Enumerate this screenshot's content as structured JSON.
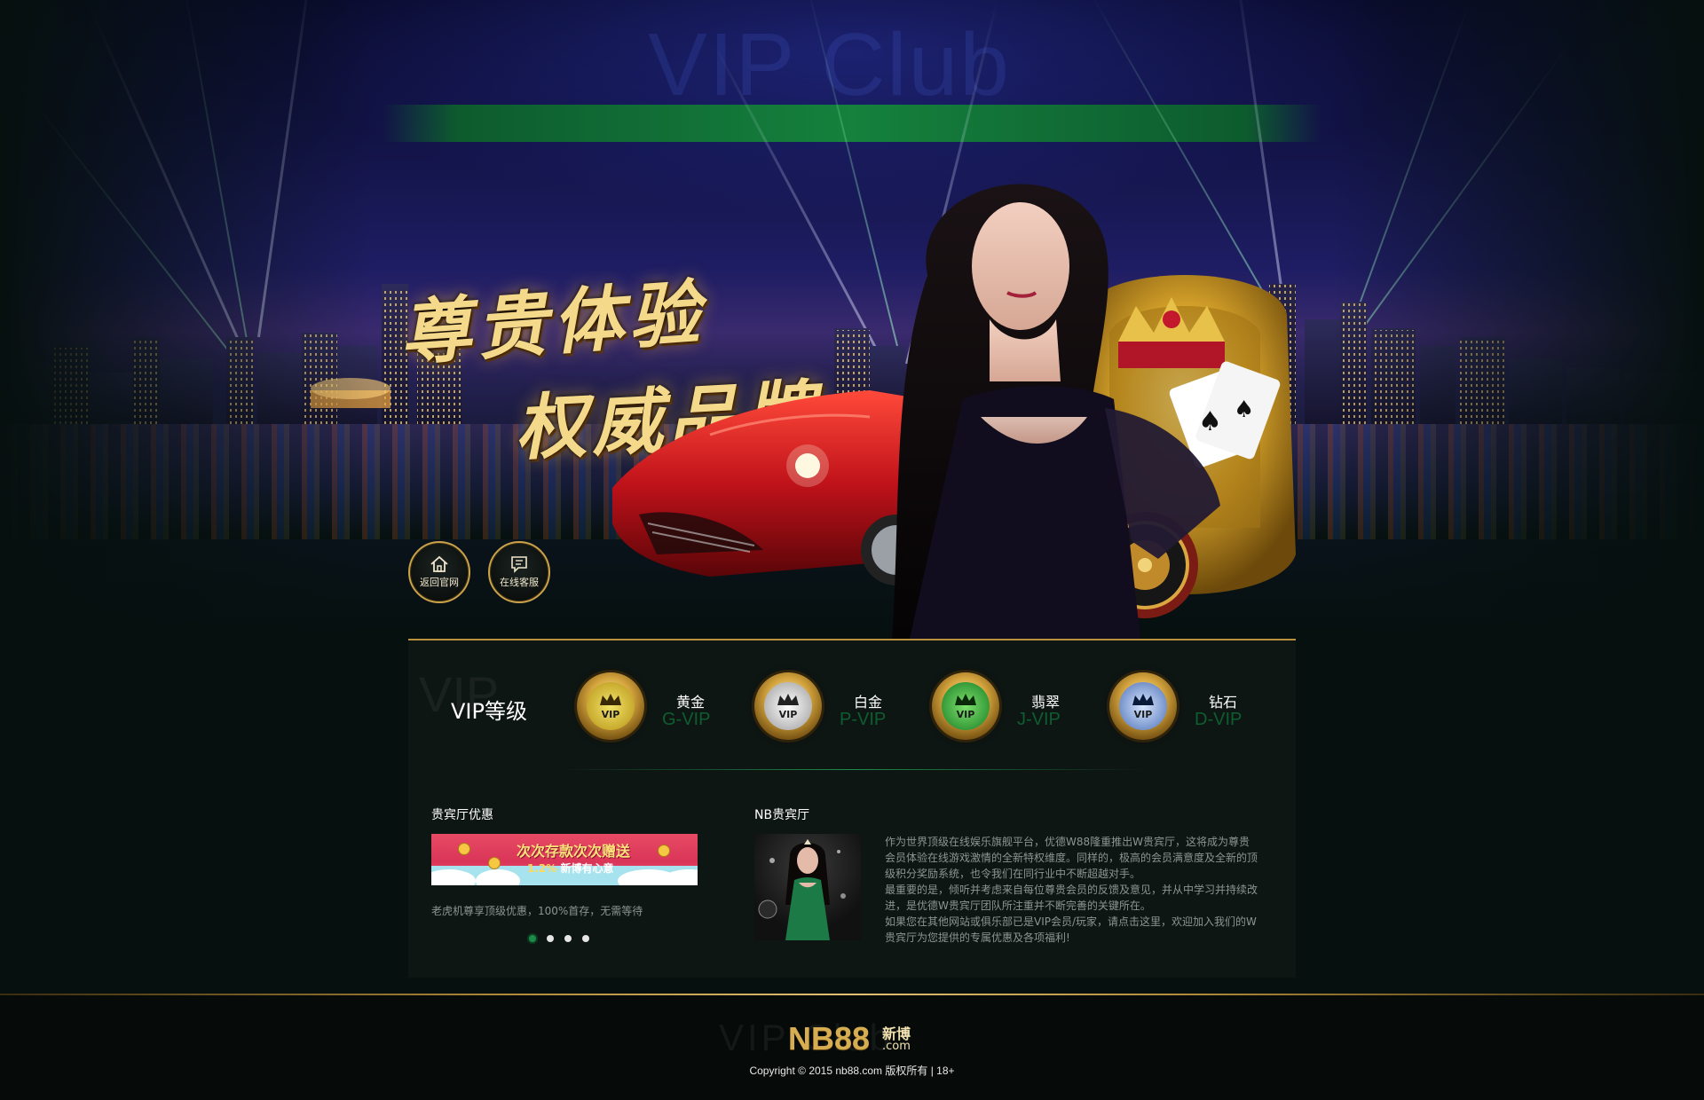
{
  "hero": {
    "watermark": "VIP Club",
    "headline_line1": "尊贵体验",
    "headline_line2": "权威品牌",
    "buttons": {
      "home_label": "返回官网",
      "service_label": "在线客服"
    }
  },
  "vip": {
    "watermark": "VIP",
    "title": "VIP等级",
    "badge_text": "VIP",
    "tiers": [
      {
        "name": "黄金",
        "sub": "G-VIP",
        "color": "#e0b82e"
      },
      {
        "name": "白金",
        "sub": "P-VIP",
        "color": "#cfcfcf"
      },
      {
        "name": "翡翠",
        "sub": "J-VIP",
        "color": "#2ea43c"
      },
      {
        "name": "钻石",
        "sub": "D-VIP",
        "color": "#6a8fd6"
      }
    ]
  },
  "promo": {
    "title": "贵宾厅优惠",
    "banner_line1": "次次存款次次赠送",
    "banner_rate": "1.2%",
    "banner_line2": "新博有心意",
    "text": "老虎机尊享顶级优惠，100%首存，无需等待"
  },
  "hall": {
    "title": "NB贵宾厅",
    "paragraphs": [
      "作为世界顶级在线娱乐旗舰平台，优德W88隆重推出W贵宾厅，这将成为尊贵会员体验在线游戏激情的全新特权维度。同样的，极高的会员满意度及全新的顶级积分奖励系统，也令我们在同行业中不断超越对手。",
      "最重要的是，倾听并考虑来自每位尊贵会员的反馈及意见，并从中学习并持续改进，是优德W贵宾厅团队所注重并不断完善的关键所在。",
      "如果您在其他网站或俱乐部已是VIP会员/玩家，请点击这里，欢迎加入我们的W贵宾厅为您提供的专属优惠及各项福利!"
    ]
  },
  "footer": {
    "watermark": "VIP Club",
    "logo": "NB88",
    "logo_cn": "新博",
    "logo_com": ".com",
    "copyright": "Copyright © 2015 nb88.com  版权所有 | 18+"
  },
  "colors": {
    "accent_gold": "#c9a24b",
    "accent_green": "#1e8a4a"
  }
}
